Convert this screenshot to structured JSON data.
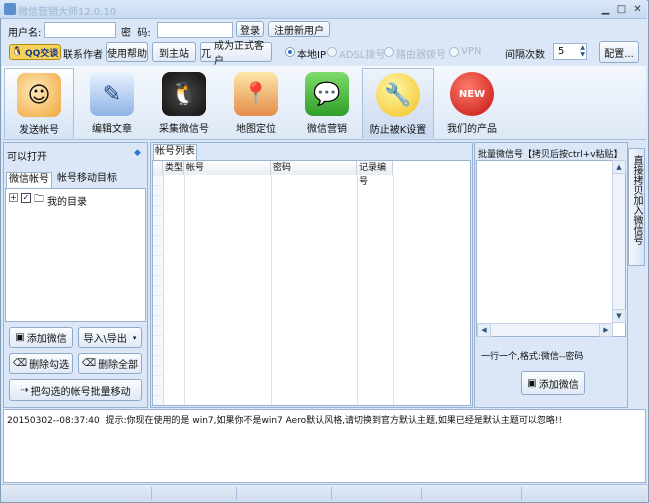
{
  "window": {
    "title": "微信营销大师12.0.10"
  },
  "login": {
    "account_label": "用户名:",
    "password_label": "密  码:",
    "login_button": "登录",
    "register_button": "注册新用户"
  },
  "toolbar": {
    "qq_button": "QQ交谈",
    "contact_author": "联系作者",
    "help": "使用帮助",
    "to_main_site": "到主站",
    "become_customer": "成为正式客户",
    "become_customer_prefix": "兀",
    "radio_local_ip": "本地IP",
    "radio_adsl": "ADSL拨号",
    "radio_router": "路由器拨号",
    "radio_vpn": "VPN",
    "interval_label": "间隔次数",
    "interval_value": "5",
    "config_button": "配置..."
  },
  "nav": {
    "items": [
      {
        "label": "发送帐号",
        "icon": "user-send-icon"
      },
      {
        "label": "编辑文章",
        "icon": "edit-article-icon"
      },
      {
        "label": "采集微信号",
        "icon": "penguin-collect-icon"
      },
      {
        "label": "地图定位",
        "icon": "map-pin-icon"
      },
      {
        "label": "微信营销",
        "icon": "wechat-icon"
      },
      {
        "label": "防止被K设置",
        "icon": "wrench-icon"
      },
      {
        "label": "我们的产品",
        "icon": "new-badge-icon"
      }
    ]
  },
  "left_panel": {
    "header": "可以打开",
    "tab_accounts": "微信帐号",
    "tab_move_target": "帐号移动目标",
    "tree_root": "我的目录",
    "btn_add_wechat": "添加微信",
    "btn_import_export": "导入\\导出",
    "btn_delete_checked": "删除勾选",
    "btn_delete_all": "删除全部",
    "btn_batch_move": "把勾选的帐号批量移动"
  },
  "middle_panel": {
    "tab": "帐号列表",
    "columns": [
      "类型",
      "帐号",
      "密码",
      "记录编号"
    ]
  },
  "right_panel": {
    "header": "批量微信号【拷贝后按ctrl+v粘贴】",
    "side_tab": "直接拷贝加入微信号",
    "hint": "一行一个,格式:微信--密码",
    "btn_add_wechat": "添加微信"
  },
  "log": {
    "entry": "20150302--08:37:40  提示:你现在使用的是 win7,如果你不是win7 Aero默认风格,请切换到官方默认主题,如果已经是默认主题可以忽略!!"
  }
}
